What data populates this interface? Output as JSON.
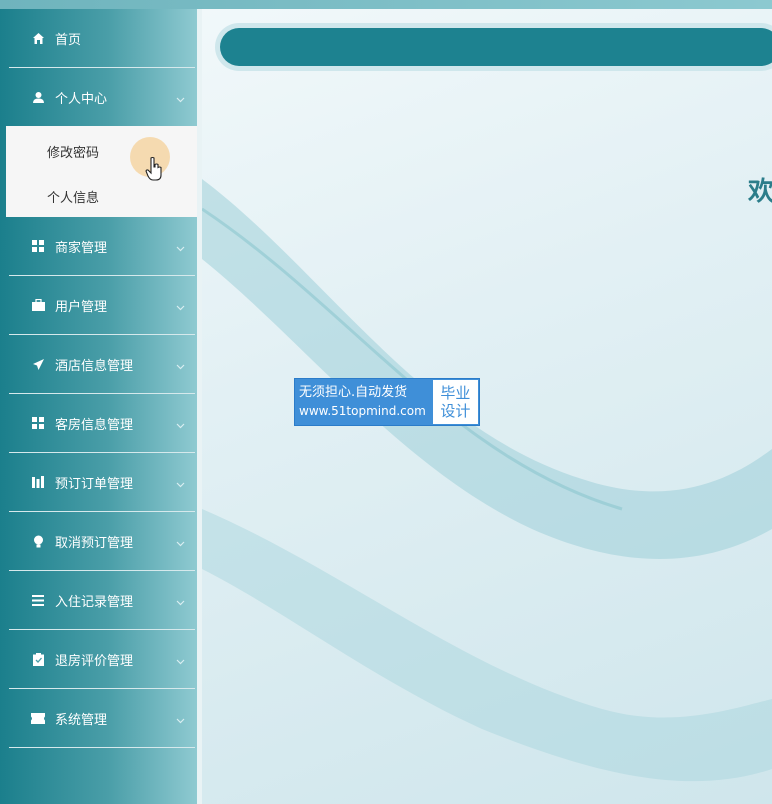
{
  "sidebar": {
    "items": [
      {
        "label": "首页",
        "icon": "home-icon",
        "has_chevron": false
      },
      {
        "label": "个人中心",
        "icon": "user-icon",
        "has_chevron": true
      },
      {
        "label": "商家管理",
        "icon": "grid-icon",
        "has_chevron": true
      },
      {
        "label": "用户管理",
        "icon": "briefcase-icon",
        "has_chevron": true
      },
      {
        "label": "酒店信息管理",
        "icon": "paper-plane-icon",
        "has_chevron": true
      },
      {
        "label": "客房信息管理",
        "icon": "grid-icon",
        "has_chevron": true
      },
      {
        "label": "预订订单管理",
        "icon": "chart-icon",
        "has_chevron": true
      },
      {
        "label": "取消预订管理",
        "icon": "bulb-icon",
        "has_chevron": true
      },
      {
        "label": "入住记录管理",
        "icon": "list-icon",
        "has_chevron": true
      },
      {
        "label": "退房评价管理",
        "icon": "clipboard-icon",
        "has_chevron": true
      },
      {
        "label": "系统管理",
        "icon": "ticket-icon",
        "has_chevron": true
      }
    ],
    "submenu": [
      {
        "label": "修改密码"
      },
      {
        "label": "个人信息"
      }
    ]
  },
  "main": {
    "welcome_text": "欢"
  },
  "watermark": {
    "line1": "无须担心.自动发货",
    "line2": "www.51topmind.com",
    "right_line1": "毕业",
    "right_line2": "设计"
  },
  "colors": {
    "sidebar_dark": "#1b7f8c",
    "header_bar": "#1d8290",
    "welcome": "#2b7d8a",
    "badge_blue": "#3f8fd8"
  }
}
